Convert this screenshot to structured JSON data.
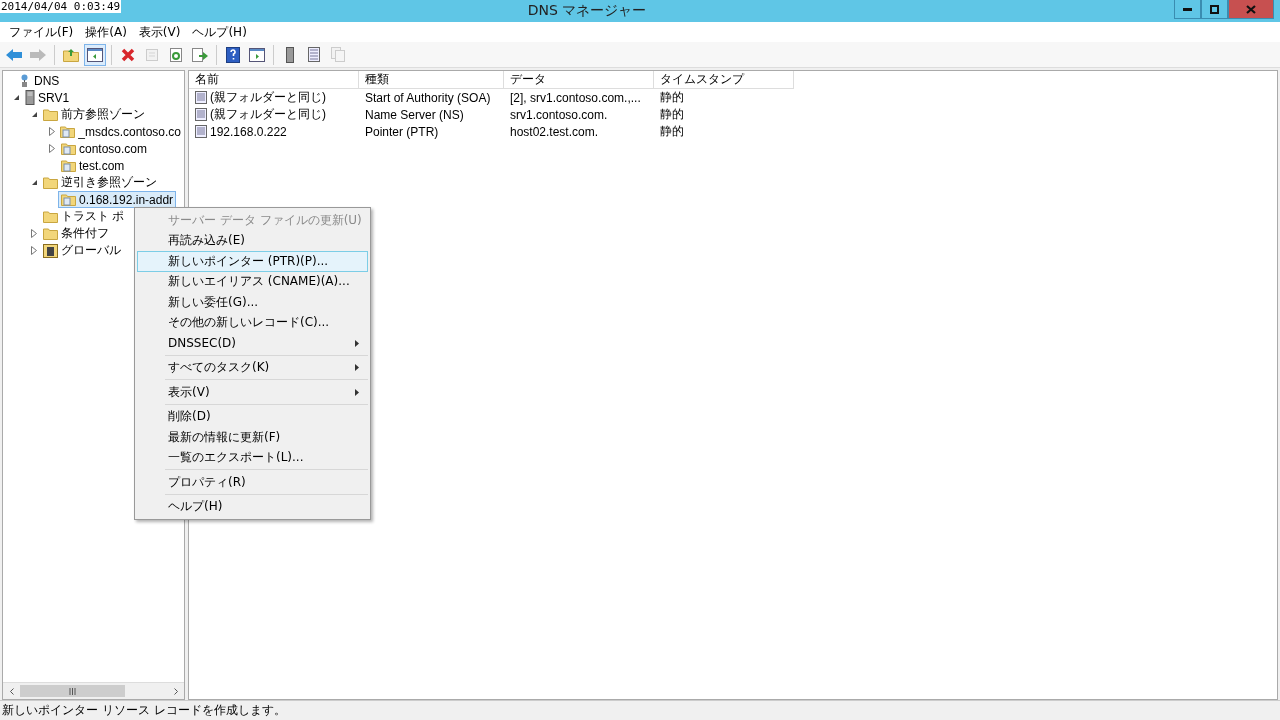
{
  "clock": "2014/04/04 0:03:49",
  "window": {
    "title": "DNS マネージャー"
  },
  "menubar": [
    "ファイル(F)",
    "操作(A)",
    "表示(V)",
    "ヘルプ(H)"
  ],
  "toolbar": [
    {
      "kind": "back",
      "disabled": false
    },
    {
      "kind": "forward",
      "disabled": true
    },
    {
      "kind": "sep"
    },
    {
      "kind": "up",
      "disabled": false
    },
    {
      "kind": "pane",
      "disabled": false,
      "selected": true
    },
    {
      "kind": "sep"
    },
    {
      "kind": "delete",
      "disabled": false
    },
    {
      "kind": "props",
      "disabled": true
    },
    {
      "kind": "refresh",
      "disabled": false
    },
    {
      "kind": "export",
      "disabled": false
    },
    {
      "kind": "sep"
    },
    {
      "kind": "help",
      "disabled": false
    },
    {
      "kind": "pane2",
      "disabled": false
    },
    {
      "kind": "sep"
    },
    {
      "kind": "server",
      "disabled": false
    },
    {
      "kind": "list",
      "disabled": false
    },
    {
      "kind": "copy",
      "disabled": true
    }
  ],
  "tree": [
    {
      "label": "DNS",
      "kind": "root",
      "selected": false,
      "children": [
        {
          "label": "SRV1",
          "kind": "server",
          "expanded": true,
          "selected": false,
          "children": [
            {
              "label": "前方参照ゾーン",
              "kind": "folder",
              "expanded": true,
              "selected": false,
              "children": [
                {
                  "label": "_msdcs.contoso.co",
                  "kind": "zone",
                  "expanded": false,
                  "selected": false
                },
                {
                  "label": "contoso.com",
                  "kind": "zone",
                  "expanded": false,
                  "selected": false
                },
                {
                  "label": "test.com",
                  "kind": "zone",
                  "selected": false
                }
              ]
            },
            {
              "label": "逆引き参照ゾーン",
              "kind": "folder",
              "expanded": true,
              "selected": false,
              "children": [
                {
                  "label": "0.168.192.in-addr",
                  "kind": "zone",
                  "selected": true
                }
              ]
            },
            {
              "label": "トラスト ポ",
              "kind": "folder",
              "selected": false
            },
            {
              "label": "条件付フ",
              "kind": "folder",
              "expanded": false,
              "selected": false
            },
            {
              "label": "グローバル",
              "kind": "global",
              "expanded": false,
              "selected": false
            }
          ]
        }
      ]
    }
  ],
  "table": {
    "columns": [
      "名前",
      "種類",
      "データ",
      "タイムスタンプ"
    ],
    "rows": [
      {
        "cells": [
          "(親フォルダーと同じ)",
          "Start of Authority (SOA)",
          "[2], srv1.contoso.com.,...",
          "静的"
        ]
      },
      {
        "cells": [
          "(親フォルダーと同じ)",
          "Name Server (NS)",
          "srv1.contoso.com.",
          "静的"
        ]
      },
      {
        "cells": [
          "192.168.0.222",
          "Pointer (PTR)",
          "host02.test.com.",
          "静的"
        ]
      }
    ]
  },
  "context_menu": [
    {
      "kind": "item",
      "label": "サーバー データ ファイルの更新(U)",
      "disabled": true,
      "selected": false,
      "submenu": false
    },
    {
      "kind": "item",
      "label": "再読み込み(E)",
      "disabled": false,
      "selected": false,
      "submenu": false
    },
    {
      "kind": "item",
      "label": "新しいポインター (PTR)(P)...",
      "disabled": false,
      "selected": true,
      "submenu": false
    },
    {
      "kind": "item",
      "label": "新しいエイリアス (CNAME)(A)...",
      "disabled": false,
      "selected": false,
      "submenu": false
    },
    {
      "kind": "item",
      "label": "新しい委任(G)...",
      "disabled": false,
      "selected": false,
      "submenu": false
    },
    {
      "kind": "item",
      "label": "その他の新しいレコード(C)...",
      "disabled": false,
      "selected": false,
      "submenu": false
    },
    {
      "kind": "item",
      "label": "DNSSEC(D)",
      "disabled": false,
      "selected": false,
      "submenu": true
    },
    {
      "kind": "separator"
    },
    {
      "kind": "item",
      "label": "すべてのタスク(K)",
      "disabled": false,
      "selected": false,
      "submenu": true
    },
    {
      "kind": "separator"
    },
    {
      "kind": "item",
      "label": "表示(V)",
      "disabled": false,
      "selected": false,
      "submenu": true
    },
    {
      "kind": "separator"
    },
    {
      "kind": "item",
      "label": "削除(D)",
      "disabled": false,
      "selected": false,
      "submenu": false
    },
    {
      "kind": "item",
      "label": "最新の情報に更新(F)",
      "disabled": false,
      "selected": false,
      "submenu": false
    },
    {
      "kind": "item",
      "label": "一覧のエクスポート(L)...",
      "disabled": false,
      "selected": false,
      "submenu": false
    },
    {
      "kind": "separator"
    },
    {
      "kind": "item",
      "label": "プロパティ(R)",
      "disabled": false,
      "selected": false,
      "submenu": false
    },
    {
      "kind": "separator"
    },
    {
      "kind": "item",
      "label": "ヘルプ(H)",
      "disabled": false,
      "selected": false,
      "submenu": false
    }
  ],
  "status_bar": "新しいポインター リソース レコードを作成します。"
}
